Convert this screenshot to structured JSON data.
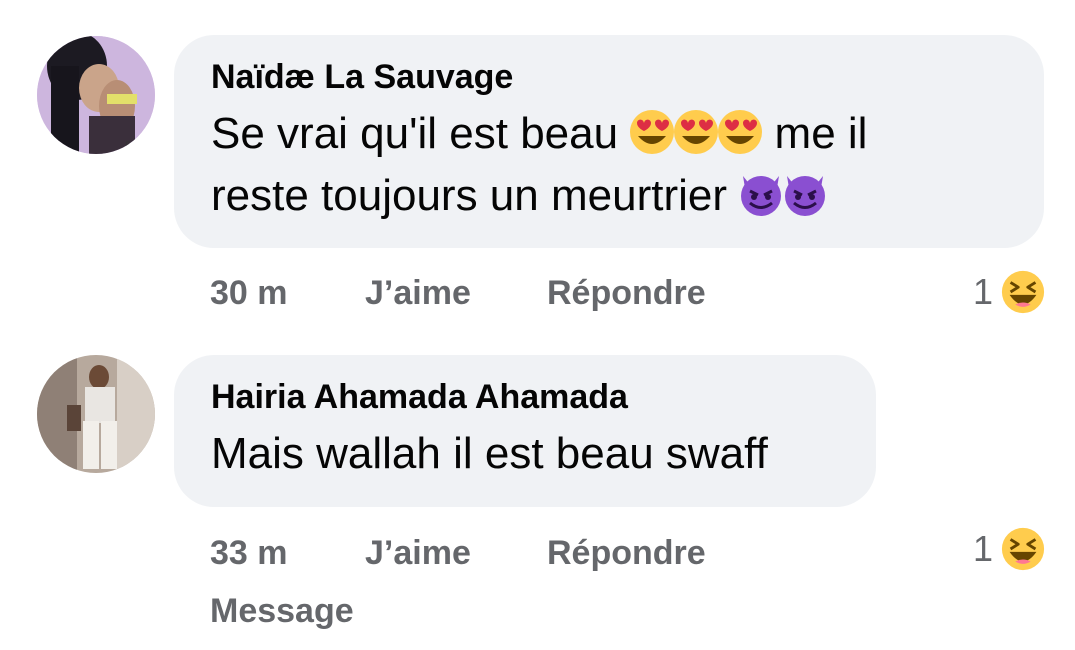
{
  "comments": [
    {
      "author": "Naïdæ La Sauvage",
      "text_line1_a": "Se vrai qu'il est beau ",
      "text_line1_b": " me il",
      "text_line2": "reste toujours un meurtrier ",
      "emojis_inline": [
        "heart-eyes-emoji",
        "heart-eyes-emoji",
        "heart-eyes-emoji",
        "smiling-devil-emoji",
        "smiling-devil-emoji"
      ],
      "time": "30 m",
      "like_label": "J’aime",
      "reply_label": "Répondre",
      "reaction_count": "1",
      "reaction_icon": "laughing-emoji"
    },
    {
      "author": "Hairia Ahamada Ahamada",
      "text": "Mais wallah il est beau swaff",
      "time": "33 m",
      "like_label": "J’aime",
      "reply_label": "Répondre",
      "reaction_count": "1",
      "reaction_icon": "laughing-emoji"
    }
  ],
  "message_label": "Message",
  "colors": {
    "bubble_bg": "#f0f2f5",
    "text": "#050505",
    "meta": "#65676b",
    "emoji_yellow": "#ffcc4d",
    "devil_purple": "#8a4fd1"
  }
}
